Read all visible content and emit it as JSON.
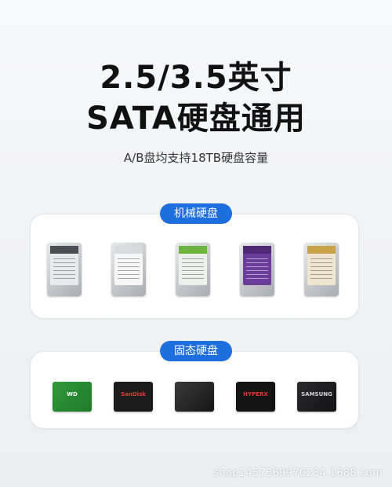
{
  "heading": {
    "line1": "2.5/3.5英寸",
    "line2": "SATA硬盘通用",
    "subtitle": "A/B盘均支持18TB硬盘容量"
  },
  "sections": {
    "hdd": {
      "label": "机械硬盘",
      "items": [
        {
          "icon": "hdd-gray-icon",
          "color": "#4b4f55"
        },
        {
          "icon": "hdd-white-icon",
          "color": "#f2f3f4"
        },
        {
          "icon": "hdd-green-icon",
          "color": "#6db33f"
        },
        {
          "icon": "hdd-purple-icon",
          "color": "#6a3d9a"
        },
        {
          "icon": "hdd-gold-icon",
          "color": "#c9a24a"
        }
      ]
    },
    "ssd": {
      "label": "固态硬盘",
      "items": [
        {
          "icon": "ssd-wd-green-icon",
          "color": "#2f9a3a",
          "brand": "WD"
        },
        {
          "icon": "ssd-sandisk-icon",
          "color": "#1b1b1b",
          "brand": "SanDisk"
        },
        {
          "icon": "ssd-black-icon",
          "color": "#2a2a2a",
          "brand": ""
        },
        {
          "icon": "ssd-hyperx-icon",
          "color": "#141414",
          "brand": "HYPERX"
        },
        {
          "icon": "ssd-samsung-icon",
          "color": "#1f1f22",
          "brand": "SAMSUNG"
        }
      ]
    }
  },
  "watermark": "shop1457369970234.1688.com"
}
